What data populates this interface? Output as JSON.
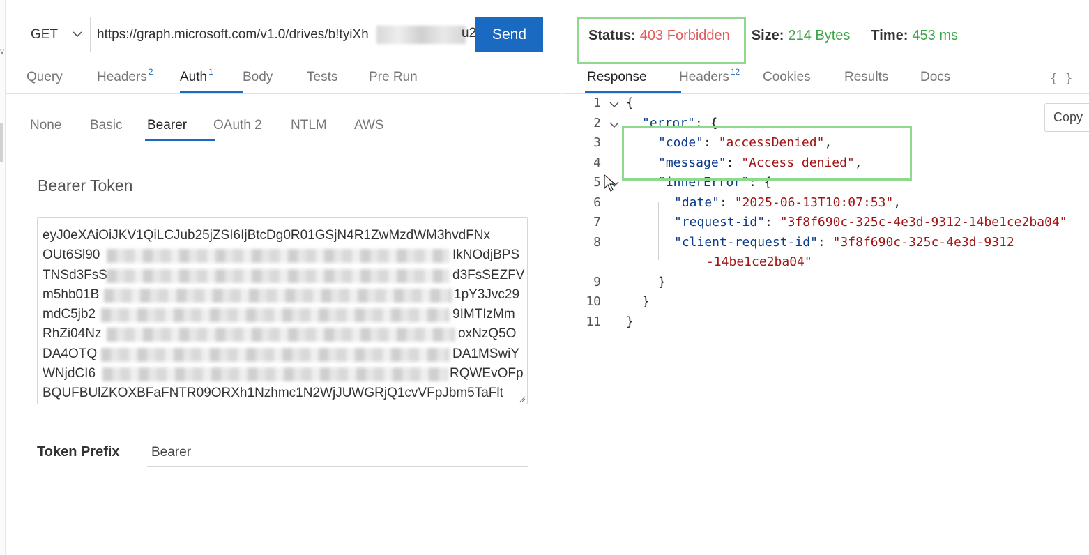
{
  "request": {
    "method": "GET",
    "url": "https://graph.microsoft.com/v1.0/drives/b!tyiXh",
    "url_tail": "u2",
    "send_label": "Send"
  },
  "request_tabs": [
    {
      "label": "Query",
      "badge": ""
    },
    {
      "label": "Headers",
      "badge": "2"
    },
    {
      "label": "Auth",
      "badge": "1"
    },
    {
      "label": "Body",
      "badge": ""
    },
    {
      "label": "Tests",
      "badge": ""
    },
    {
      "label": "Pre Run",
      "badge": ""
    }
  ],
  "auth_tabs": [
    "None",
    "Basic",
    "Bearer",
    "OAuth 2",
    "NTLM",
    "AWS"
  ],
  "bearer": {
    "label": "Bearer Token",
    "token_lines": [
      {
        "left": "eyJ0eXAiOiJKV1QiLCJub25jZSI6IjBtcDg0R01GSjN4R1ZwMzdWM3hvdFNx",
        "right": ""
      },
      {
        "left": "OUt6Sl90",
        "right": "IkNOdjBPS"
      },
      {
        "left": "TNSd3FsS",
        "right": "d3FsSEZFV"
      },
      {
        "left": "m5hb01B",
        "right": "1pY3Jvc29"
      },
      {
        "left": "mdC5jb2",
        "right": "9IMTIzMm"
      },
      {
        "left": "RhZi04Nz",
        "right": "oxNzQ5O"
      },
      {
        "left": "DA4OTQ",
        "right": "DA1MSwiY"
      },
      {
        "left": "WNjdCI6",
        "right": "RQWEvOFp"
      },
      {
        "left": "BQUFBUlZKOXBFaFNTR09ORXh1Nzhmc1N2WjJUWGRjQ1cvVFpJbm5TaFlt",
        "right": ""
      }
    ],
    "prefix_label": "Token Prefix",
    "prefix_value": "Bearer"
  },
  "response": {
    "status_label": "Status:",
    "status_value": "403 Forbidden",
    "size_label": "Size:",
    "size_value": "214 Bytes",
    "time_label": "Time:",
    "time_value": "453 ms",
    "tabs": [
      {
        "label": "Response",
        "badge": ""
      },
      {
        "label": "Headers",
        "badge": "12"
      },
      {
        "label": "Cookies",
        "badge": ""
      },
      {
        "label": "Results",
        "badge": ""
      },
      {
        "label": "Docs",
        "badge": ""
      }
    ],
    "braces_label": "{ }",
    "copy_label": "Copy",
    "line_numbers": [
      "1",
      "2",
      "3",
      "4",
      "5",
      "6",
      "7",
      "8",
      "9",
      "10",
      "11"
    ],
    "body": {
      "open_brace": "{",
      "error_key": "\"error\"",
      "code_key": "\"code\"",
      "code_value": "\"accessDenied\"",
      "message_key": "\"message\"",
      "message_value": "\"Access denied\"",
      "inner_key": "\"innerError\"",
      "date_key": "\"date\"",
      "date_value": "\"2025-06-13T10:07:53\"",
      "request_id_key": "\"request-id\"",
      "request_id_value": "\"3f8f690c-325c-4e3d-9312-14be1ce2ba04\"",
      "client_request_id_key": "\"client-request-id\"",
      "client_request_id_value_1": "\"3f8f690c-325c-4e3d-9312",
      "client_request_id_value_2": "-14be1ce2ba04\"",
      "close_brace": "}"
    }
  },
  "colors": {
    "accent": "#1b6ac1",
    "status_error": "#e25a5a",
    "status_ok": "#3ea64a",
    "highlight_box": "#8fd98f",
    "json_key": "#0b3c8c",
    "json_string": "#a31515"
  },
  "icons": {
    "method_dropdown": "chevron-down-icon",
    "fold": "chevron-down-icon",
    "cursor": "mouse-pointer-icon"
  }
}
